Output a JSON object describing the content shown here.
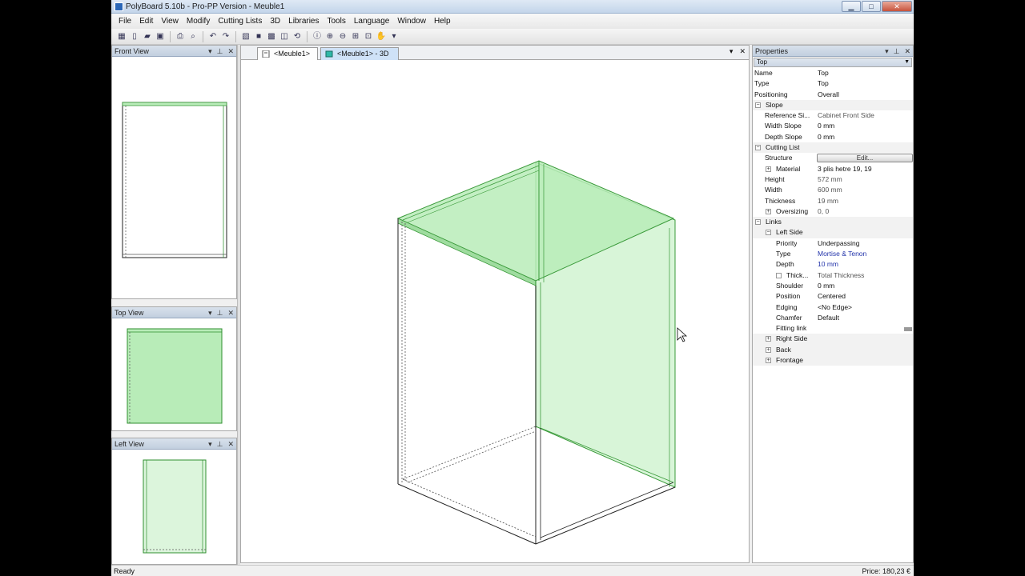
{
  "window": {
    "title": "PolyBoard 5.10b - Pro-PP Version - Meuble1"
  },
  "menu": [
    "File",
    "Edit",
    "View",
    "Modify",
    "Cutting Lists",
    "3D",
    "Libraries",
    "Tools",
    "Language",
    "Window",
    "Help"
  ],
  "panels": {
    "front": {
      "title": "Front View"
    },
    "top": {
      "title": "Top View"
    },
    "left": {
      "title": "Left View"
    }
  },
  "tabs": [
    {
      "label": "<Meuble1>"
    },
    {
      "label": "<Meuble1> - 3D"
    }
  ],
  "properties": {
    "title": "Properties",
    "selected": "Top",
    "edit_label": "Edit...",
    "rows": [
      {
        "name": "Name",
        "value": "Top"
      },
      {
        "name": "Type",
        "value": "Top"
      },
      {
        "name": "Positioning",
        "value": "Overall"
      },
      {
        "name": "Slope",
        "value": ""
      },
      {
        "name": "Reference Si...",
        "value": "Cabinet Front Side"
      },
      {
        "name": "Width Slope",
        "value": "0 mm"
      },
      {
        "name": "Depth Slope",
        "value": "0 mm"
      },
      {
        "name": "Cutting List",
        "value": ""
      },
      {
        "name": "Structure",
        "value": ""
      },
      {
        "name": "Material",
        "value": "3 plis hetre 19, 19"
      },
      {
        "name": "Height",
        "value": "572 mm"
      },
      {
        "name": "Width",
        "value": "600 mm"
      },
      {
        "name": "Thickness",
        "value": "19 mm"
      },
      {
        "name": "Oversizing",
        "value": "0, 0"
      },
      {
        "name": "Links",
        "value": ""
      },
      {
        "name": "Left Side",
        "value": ""
      },
      {
        "name": "Priority",
        "value": "Underpassing"
      },
      {
        "name": "Type",
        "value": "Mortise & Tenon"
      },
      {
        "name": "Depth",
        "value": "10 mm"
      },
      {
        "name": "Thick...",
        "value": "Total Thickness"
      },
      {
        "name": "Shoulder",
        "value": "0 mm"
      },
      {
        "name": "Position",
        "value": "Centered"
      },
      {
        "name": "Edging",
        "value": "<No Edge>"
      },
      {
        "name": "Chamfer",
        "value": "Default"
      },
      {
        "name": "Fitting link",
        "value": ""
      },
      {
        "name": "Right Side",
        "value": ""
      },
      {
        "name": "Back",
        "value": ""
      },
      {
        "name": "Frontage",
        "value": ""
      }
    ]
  },
  "status": {
    "left": "Ready",
    "right": "Price: 180,23 €"
  },
  "colors": {
    "panel_green": "#b8ecb8",
    "edge_green": "#4caf50"
  }
}
